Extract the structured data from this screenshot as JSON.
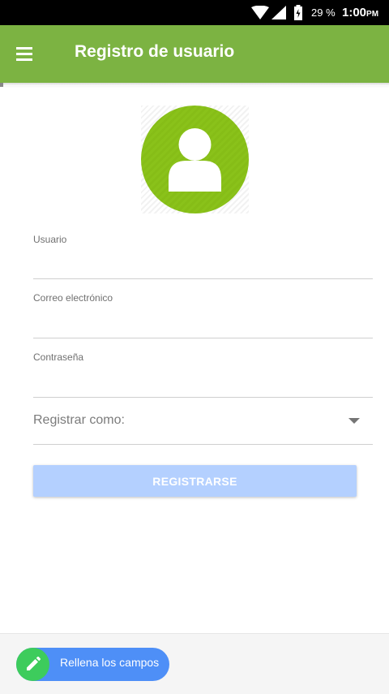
{
  "status_bar": {
    "battery_percent": "29 %",
    "time": "1:00",
    "ampm": "PM"
  },
  "app_bar": {
    "title": "Registro de usuario"
  },
  "form": {
    "username_label": "Usuario",
    "username_value": "",
    "email_label": "Correo electrónico",
    "email_value": "",
    "password_label": "Contraseña",
    "password_value": "",
    "role_select_label": "Registrar como:",
    "register_button": "REGISTRARSE"
  },
  "toast": {
    "message": "Rellena los campos"
  },
  "colors": {
    "app_bar": "#7cb342",
    "avatar": "#86bd17",
    "button": "#b4d0ff",
    "toast": "#4e8ff7",
    "toast_icon": "#3dcc5c"
  },
  "icons": [
    "wifi-icon",
    "signal-icon",
    "battery-icon",
    "menu-icon",
    "user-avatar-icon",
    "chevron-down-icon",
    "pencil-icon"
  ]
}
